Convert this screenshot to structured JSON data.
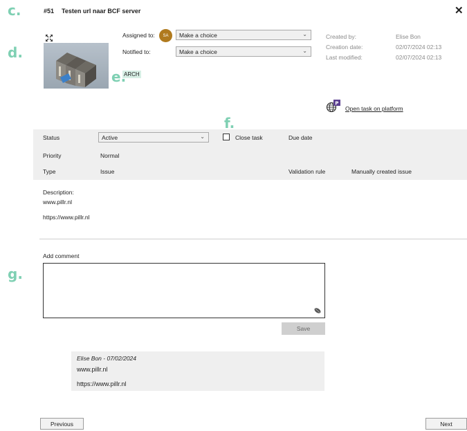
{
  "callouts": {
    "c": "c.",
    "d": "d.",
    "e": "e.",
    "f": "f.",
    "g": "g."
  },
  "header": {
    "task_number": "#51",
    "title": "Testen url naar BCF server",
    "close_symbol": "✕"
  },
  "assignment": {
    "assigned_label": "Assigned to:",
    "assignee_initials": "SA",
    "assigned_value": "Make a choice",
    "notified_label": "Notified to:",
    "notified_value": "Make a choice"
  },
  "tag": "ARCH",
  "meta": {
    "created_by_label": "Created by:",
    "created_by": "Elise Bon",
    "creation_date_label": "Creation date:",
    "creation_date": "02/07/2024 02:13",
    "last_modified_label": "Last modified:",
    "last_modified": "02/07/2024 02:13"
  },
  "platform_link": "Open task on platform",
  "details": {
    "status_label": "Status",
    "status_value": "Active",
    "close_task_label": "Close task",
    "close_task_checked": false,
    "due_date_label": "Due date",
    "priority_label": "Priority",
    "priority_value": "Normal",
    "type_label": "Type",
    "type_value": "Issue",
    "validation_rule_label": "Validation rule",
    "validation_rule_value": "Manually created issue"
  },
  "description": {
    "label": "Description:",
    "line1": "www.pillr.nl",
    "line2": "https://www.pillr.nl"
  },
  "comment": {
    "label": "Add comment",
    "value": "",
    "save_label": "Save"
  },
  "comments": [
    {
      "author_date": "Elise Bon - 07/02/2024",
      "line1": "www.pillr.nl",
      "line2": "https://www.pillr.nl"
    }
  ],
  "nav": {
    "previous": "Previous",
    "next": "Next"
  },
  "colors": {
    "callout": "#7fd0b3",
    "band": "#efefef",
    "avatar": "#b07a1e"
  }
}
